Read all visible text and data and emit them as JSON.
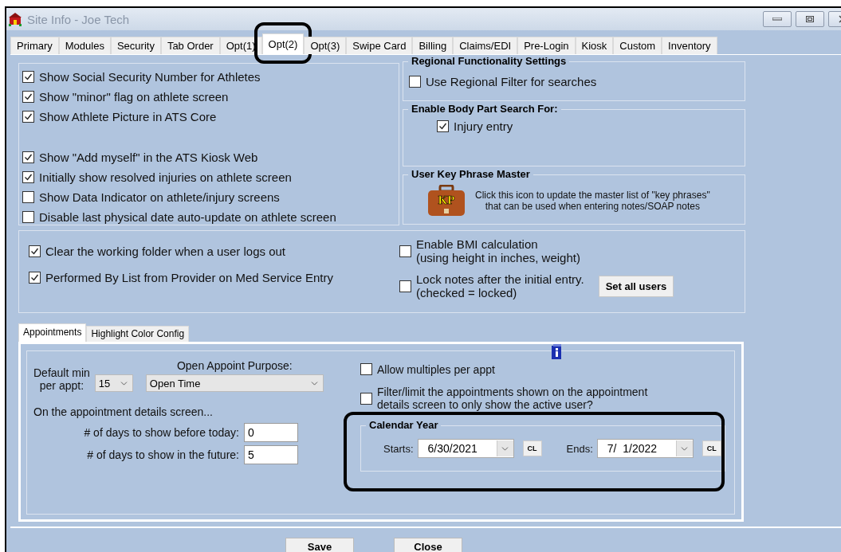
{
  "window": {
    "title": "Site Info - Joe Tech"
  },
  "tabs": [
    {
      "label": "Primary",
      "selected": false,
      "highlighted": false
    },
    {
      "label": "Modules",
      "selected": false,
      "highlighted": false
    },
    {
      "label": "Security",
      "selected": false,
      "highlighted": false
    },
    {
      "label": "Tab Order",
      "selected": false,
      "highlighted": false
    },
    {
      "label": "Opt(1)",
      "selected": false,
      "highlighted": false
    },
    {
      "label": "Opt(2)",
      "selected": true,
      "highlighted": true
    },
    {
      "label": "Opt(3)",
      "selected": false,
      "highlighted": false
    },
    {
      "label": "Swipe Card",
      "selected": false,
      "highlighted": false
    },
    {
      "label": "Billing",
      "selected": false,
      "highlighted": false
    },
    {
      "label": "Claims/EDI",
      "selected": false,
      "highlighted": false
    },
    {
      "label": "Pre-Login",
      "selected": false,
      "highlighted": false
    },
    {
      "label": "Kiosk",
      "selected": false,
      "highlighted": false
    },
    {
      "label": "Custom",
      "selected": false,
      "highlighted": false
    },
    {
      "label": "Inventory",
      "selected": false,
      "highlighted": false
    }
  ],
  "display_options": [
    {
      "label": "Show Social Security Number for Athletes",
      "checked": true,
      "spaced": false
    },
    {
      "label": "Show \"minor\" flag on athlete screen",
      "checked": true,
      "spaced": false
    },
    {
      "label": "Show Athlete Picture in ATS Core",
      "checked": true,
      "spaced": false
    },
    {
      "label": "Show \"Add myself\" in the ATS Kiosk Web",
      "checked": true,
      "spaced": true
    },
    {
      "label": "Initially show resolved injuries on athlete screen",
      "checked": true,
      "spaced": false
    },
    {
      "label": "Show Data Indicator on athlete/injury screens",
      "checked": false,
      "spaced": false
    },
    {
      "label": "Disable last physical date auto-update on athlete screen",
      "checked": false,
      "spaced": false
    }
  ],
  "regional": {
    "title": "Regional Functionality Settings",
    "options": [
      {
        "label": "Use Regional Filter for searches",
        "checked": false
      }
    ]
  },
  "body_part_search": {
    "title": "Enable Body Part Search For:",
    "options": [
      {
        "label": "Injury entry",
        "checked": true
      }
    ]
  },
  "key_phrase_master": {
    "title": "User Key Phrase Master",
    "icon_label": "KP",
    "description": [
      "Click this icon to update the master list of \"key phrases\"",
      "that can be used when entering notes/SOAP notes"
    ]
  },
  "general_options": [
    {
      "label": "Clear the working folder when a user logs out",
      "checked": true
    },
    {
      "label": "Performed By List from Provider on Med Service Entry",
      "checked": true
    }
  ],
  "note_options": [
    {
      "lines": [
        "Enable BMI calculation",
        "(using height in inches, weight)"
      ],
      "checked": false
    },
    {
      "lines": [
        "Lock notes after the initial entry.",
        "(checked = locked)"
      ],
      "checked": false
    }
  ],
  "set_all_users_button": "Set all users",
  "sub_tabs": [
    {
      "label": "Appointments",
      "selected": true
    },
    {
      "label": "Highlight Color Config",
      "selected": false
    }
  ],
  "appointments": {
    "default_min_label": [
      "Default min",
      "per appt:"
    ],
    "default_min_value": "15",
    "purpose_label": "Open Appoint Purpose:",
    "purpose_value": "Open Time",
    "details_heading": "On the appointment details screen...",
    "days_before": {
      "label": "# of days to show before today:",
      "value": "0"
    },
    "days_after": {
      "label": "# of days to show in the future:",
      "value": "5"
    },
    "allow_multiples": {
      "label": "Allow multiples per appt",
      "checked": false
    },
    "filter_active_user": {
      "lines": [
        "Filter/limit the appointments shown on the appointment",
        "details screen to only show the active user?"
      ],
      "checked": false
    },
    "calendar_year": {
      "title": "Calendar Year",
      "highlighted": true,
      "starts_label": "Starts:",
      "starts_value": "6/30/2021",
      "ends_label": "Ends:",
      "ends_value": "7/  1/2022",
      "starts_clear_button": "CL",
      "ends_clear_button": "CL"
    }
  },
  "buttons": [
    "Save",
    "Close"
  ]
}
